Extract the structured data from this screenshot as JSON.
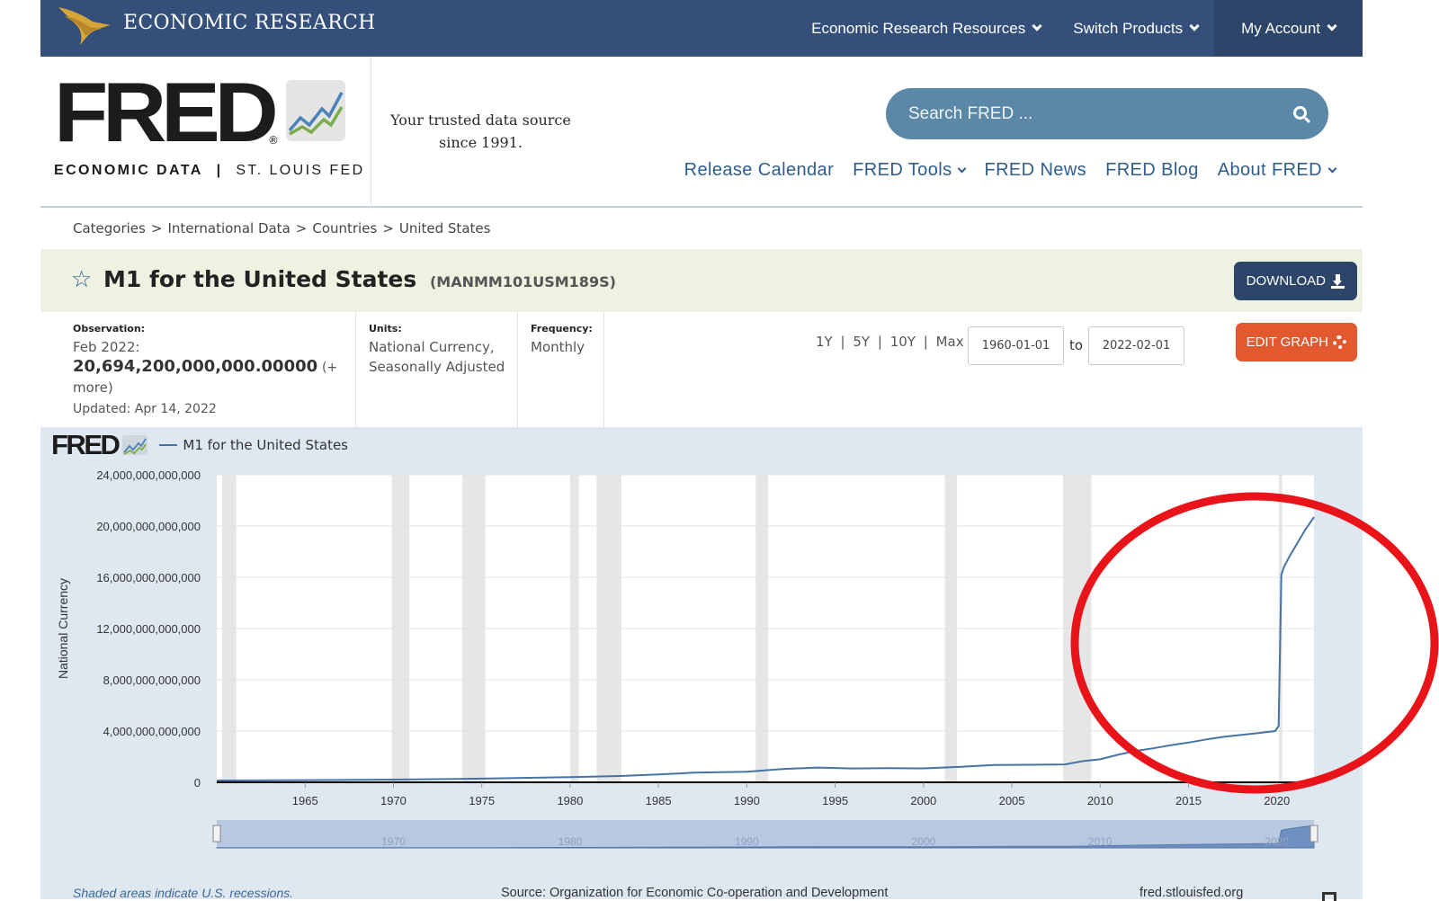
{
  "topbar": {
    "brand": "ECONOMIC RESEARCH",
    "nav": [
      "Economic Research Resources",
      "Switch Products",
      "My Account"
    ]
  },
  "header": {
    "logo_text": "FRED",
    "logo_registered": "®",
    "logo_sub_bold": "ECONOMIC DATA",
    "logo_sub_sep": "|",
    "logo_sub_rest": "ST. LOUIS FED",
    "tagline_1": "Your trusted data source",
    "tagline_2": "since 1991.",
    "search_placeholder": "Search FRED ...",
    "nav": {
      "release_calendar": "Release Calendar",
      "fred_tools": "FRED Tools",
      "fred_news": "FRED News",
      "fred_blog": "FRED Blog",
      "about_fred": "About FRED"
    }
  },
  "breadcrumb": [
    "Categories",
    "International Data",
    "Countries",
    "United States"
  ],
  "breadcrumb_sep": ">",
  "series": {
    "title": "M1 for the United States",
    "id": "(MANMM101USM189S)",
    "download_label": "DOWNLOAD",
    "observation_label": "Observation:",
    "observation_date": "Feb 2022:",
    "observation_value": "20,694,200,000,000.00000",
    "observation_more_1": "(+",
    "observation_more_2": "more)",
    "updated": "Updated: Apr 14, 2022",
    "units_label": "Units:",
    "units_1": "National Currency,",
    "units_2": "Seasonally Adjusted",
    "frequency_label": "Frequency:",
    "frequency": "Monthly",
    "range_1y": "1Y",
    "range_5y": "5Y",
    "range_10y": "10Y",
    "range_max": "Max",
    "range_sep": "|",
    "start_date": "1960-01-01",
    "to_label": "to",
    "end_date": "2022-02-01",
    "edit_graph_label": "EDIT GRAPH"
  },
  "footer": {
    "shaded_note": "Shaded areas indicate U.S. recessions.",
    "source": "Source: Organization for Economic Co-operation and Development",
    "site": "fred.stlouisfed.org"
  },
  "colors": {
    "topbar": "#34507a",
    "accent_blue": "#2f5d8c",
    "series_line": "#4572a7",
    "edit_button": "#e2592f",
    "annotation": "#e8141a"
  },
  "chart_data": {
    "type": "line",
    "title": "",
    "legend": "M1 for the United States",
    "ylabel": "National Currency",
    "xlim": [
      1960.0,
      2022.1
    ],
    "ylim": [
      0,
      24000000000000
    ],
    "yticks": [
      0,
      4000000000000,
      8000000000000,
      12000000000000,
      16000000000000,
      20000000000000,
      24000000000000
    ],
    "ytick_labels": [
      "0",
      "4,000,000,000,000",
      "8,000,000,000,000",
      "12,000,000,000,000",
      "16,000,000,000,000",
      "20,000,000,000,000",
      "24,000,000,000,000"
    ],
    "xticks": [
      1965,
      1970,
      1975,
      1980,
      1985,
      1990,
      1995,
      2000,
      2005,
      2010,
      2015,
      2020
    ],
    "navigator_labels": [
      1970,
      1980,
      1990,
      2000,
      2010,
      2020
    ],
    "grid": true,
    "recessions": [
      [
        1960.3,
        1961.1
      ],
      [
        1969.9,
        1970.9
      ],
      [
        1973.9,
        1975.2
      ],
      [
        1980.0,
        1980.5
      ],
      [
        1981.5,
        1982.9
      ],
      [
        1990.5,
        1991.2
      ],
      [
        2001.2,
        2001.9
      ],
      [
        2007.9,
        2009.5
      ],
      [
        2020.1,
        2020.3
      ]
    ],
    "series": [
      {
        "name": "M1 for the United States",
        "x": [
          1960.0,
          1965.0,
          1970.0,
          1975.0,
          1980.0,
          1983.0,
          1985.0,
          1987.0,
          1990.0,
          1992.0,
          1994.0,
          1996.0,
          1998.0,
          2000.0,
          2002.0,
          2004.0,
          2006.0,
          2008.0,
          2009.0,
          2010.0,
          2011.0,
          2012.0,
          2013.0,
          2014.0,
          2015.0,
          2016.0,
          2017.0,
          2018.0,
          2019.0,
          2019.9,
          2020.1,
          2020.25,
          2020.4,
          2020.7,
          2021.0,
          2021.3,
          2021.6,
          2021.9,
          2022.1
        ],
        "values": [
          140000000000,
          168000000000,
          210000000000,
          285000000000,
          400000000000,
          500000000000,
          620000000000,
          750000000000,
          820000000000,
          1030000000000,
          1150000000000,
          1080000000000,
          1100000000000,
          1090000000000,
          1200000000000,
          1350000000000,
          1370000000000,
          1400000000000,
          1650000000000,
          1800000000000,
          2150000000000,
          2450000000000,
          2650000000000,
          2900000000000,
          3100000000000,
          3350000000000,
          3550000000000,
          3700000000000,
          3850000000000,
          4000000000000,
          4400000000000,
          16200000000000,
          16800000000000,
          17600000000000,
          18300000000000,
          19000000000000,
          19700000000000,
          20300000000000,
          20694200000000
        ]
      }
    ]
  }
}
